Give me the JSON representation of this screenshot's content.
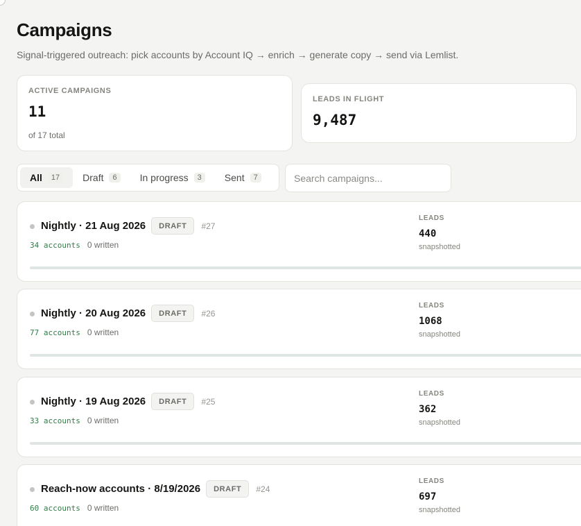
{
  "header": {
    "title": "Campaigns",
    "subtitle": "Signal-triggered outreach: pick accounts by Account IQ → enrich → generate copy → send via Lemlist."
  },
  "stats": {
    "active": {
      "label": "Active campaigns",
      "value": "11",
      "sub": "of 17 total"
    },
    "leads": {
      "label": "Leads in flight",
      "value": "9,487"
    }
  },
  "filters": {
    "tabs": [
      {
        "label": "All",
        "count": "17",
        "active": true
      },
      {
        "label": "Draft",
        "count": "6",
        "active": false
      },
      {
        "label": "In progress",
        "count": "3",
        "active": false
      },
      {
        "label": "Sent",
        "count": "7",
        "active": false
      }
    ],
    "search_placeholder": "Search campaigns..."
  },
  "campaigns": [
    {
      "name": "Nightly · 21 Aug 2026",
      "status": "DRAFT",
      "id": "#27",
      "accounts": "34 accounts",
      "written": "0 written",
      "leads_label": "LEADS",
      "leads": "440",
      "leads_sub": "snapshotted",
      "progress": 0
    },
    {
      "name": "Nightly · 20 Aug 2026",
      "status": "DRAFT",
      "id": "#26",
      "accounts": "77 accounts",
      "written": "0 written",
      "leads_label": "LEADS",
      "leads": "1068",
      "leads_sub": "snapshotted",
      "progress": 0
    },
    {
      "name": "Nightly · 19 Aug 2026",
      "status": "DRAFT",
      "id": "#25",
      "accounts": "33 accounts",
      "written": "0 written",
      "leads_label": "LEADS",
      "leads": "362",
      "leads_sub": "snapshotted",
      "progress": 0
    },
    {
      "name": "Reach-now accounts · 8/19/2026",
      "status": "DRAFT",
      "id": "#24",
      "accounts": "60 accounts",
      "written": "0 written",
      "leads_label": "LEADS",
      "leads": "697",
      "leads_sub": "snapshotted",
      "progress": 0
    }
  ],
  "colors": {
    "accent_green": "#2f7d47",
    "draft_dot": "#c4c4c0",
    "background": "#f4f4f3"
  }
}
